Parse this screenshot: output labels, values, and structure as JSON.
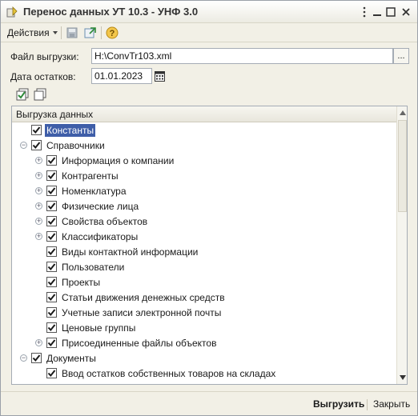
{
  "window": {
    "title": "Перенос данных УТ 10.3 - УНФ 3.0"
  },
  "toolbar": {
    "actions_label": "Действия"
  },
  "form": {
    "file_label": "Файл выгрузки:",
    "file_value": "H:\\ConvTr103.xml",
    "file_select_label": "...",
    "date_label": "Дата остатков:",
    "date_value": "01.01.2023"
  },
  "tree": {
    "header": "Выгрузка данных",
    "rows": [
      {
        "label": "Константы",
        "checked": true,
        "selected": true
      },
      {
        "label": "Справочники",
        "checked": true,
        "expander": "minus"
      },
      {
        "label": "Информация о компании",
        "checked": true,
        "expander": "plus"
      },
      {
        "label": "Контрагенты",
        "checked": true,
        "expander": "plus"
      },
      {
        "label": "Номенклатура",
        "checked": true,
        "expander": "plus"
      },
      {
        "label": "Физические лица",
        "checked": true,
        "expander": "plus"
      },
      {
        "label": "Свойства объектов",
        "checked": true,
        "expander": "plus"
      },
      {
        "label": "Классификаторы",
        "checked": true,
        "expander": "plus"
      },
      {
        "label": "Виды контактной информации",
        "checked": true
      },
      {
        "label": "Пользователи",
        "checked": true
      },
      {
        "label": "Проекты",
        "checked": true
      },
      {
        "label": "Статьи движения денежных средств",
        "checked": true
      },
      {
        "label": "Учетные записи электронной почты",
        "checked": true
      },
      {
        "label": "Ценовые группы",
        "checked": true
      },
      {
        "label": "Присоединенные файлы объектов",
        "checked": true,
        "expander": "plus"
      },
      {
        "label": "Документы",
        "checked": true,
        "expander": "minus"
      },
      {
        "label": "Ввод остатков собственных товаров на складах",
        "checked": true
      }
    ]
  },
  "footer": {
    "export_label": "Выгрузить",
    "close_label": "Закрыть"
  },
  "colors": {
    "selection": "#3f5ea8",
    "check": "#1a1a1a",
    "window_bg": "#f2f0e6"
  }
}
